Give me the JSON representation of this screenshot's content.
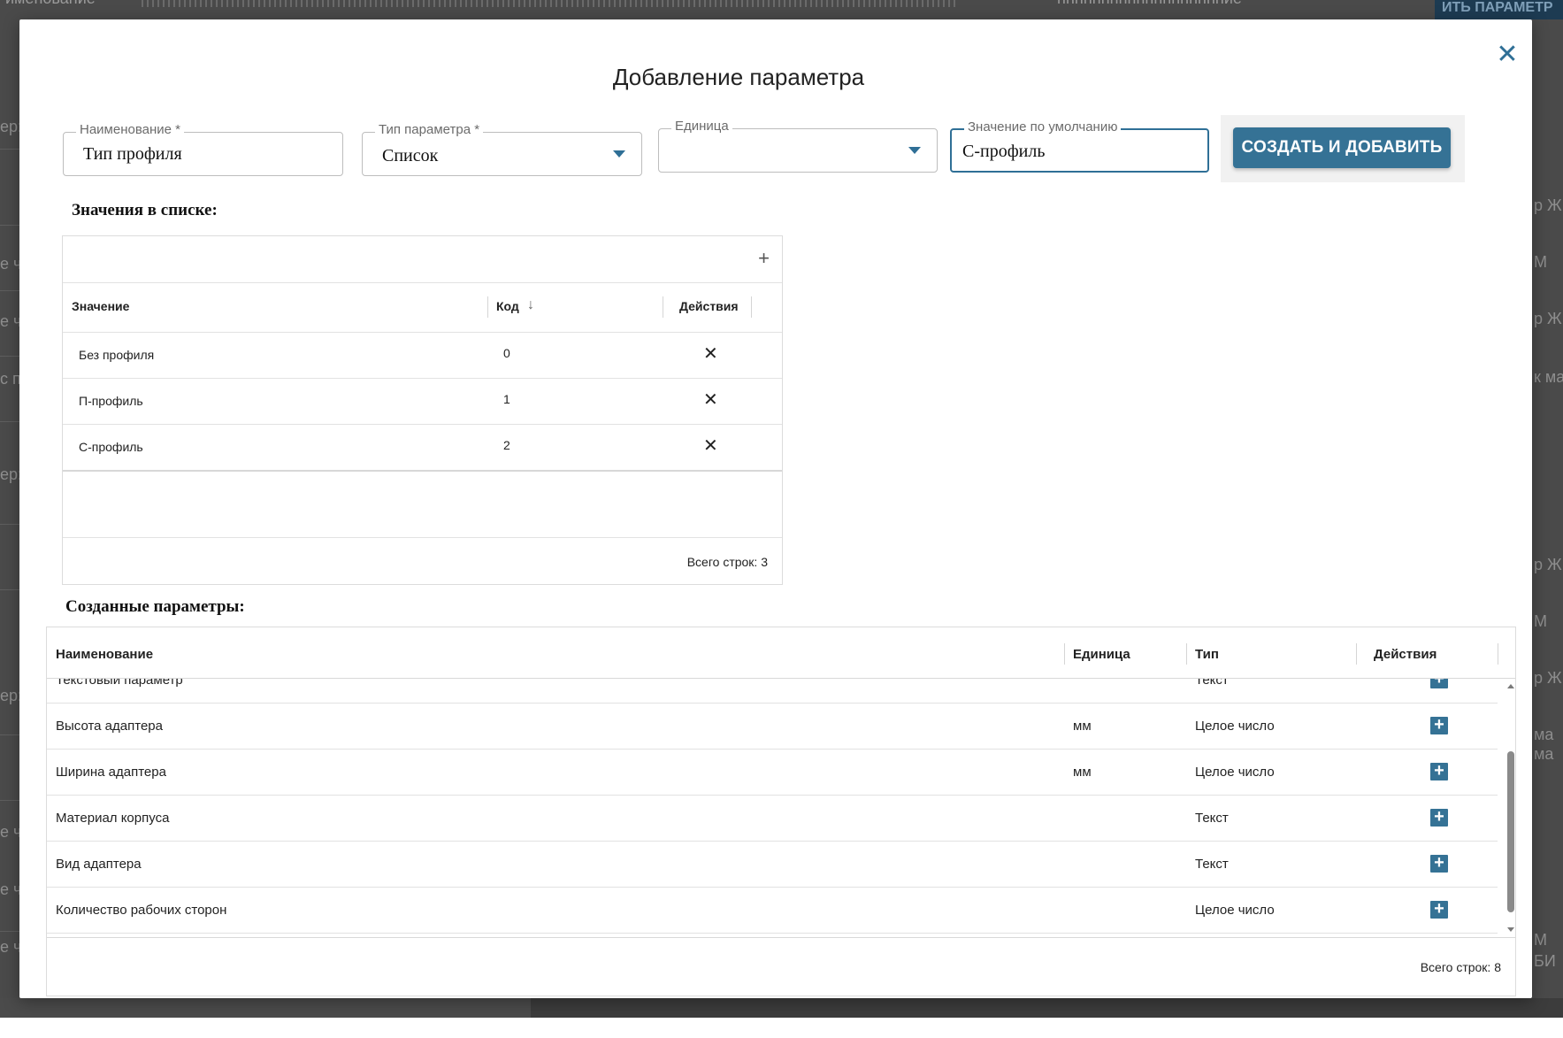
{
  "background": {
    "top_left_text": "именование",
    "top_mid_text": "ннннннннннннннннннние",
    "top_button": "ИТЬ ПАРАМЕТР",
    "left_fragments": [
      "ер:",
      "е ч",
      "е ч",
      "с п",
      "ер:",
      "ер:",
      "е ч",
      "е ч",
      "е ч"
    ],
    "right_fragments": [
      "р Ж",
      "М",
      "р Ж",
      "к ма",
      "р Ж",
      "М",
      "р Ж",
      "ма",
      "ма",
      "М",
      "БИ"
    ]
  },
  "dialog": {
    "title": "Добавление параметра",
    "close_icon": "close-icon",
    "fields": {
      "name": {
        "label": "Наименование *",
        "value": "Тип профиля"
      },
      "type": {
        "label": "Тип параметра *",
        "value": "Список"
      },
      "unit": {
        "label": "Единица",
        "value": ""
      },
      "default": {
        "label": "Значение по умолчанию",
        "value": "С-профиль"
      }
    },
    "create_button": "СОЗДАТЬ И ДОБАВИТЬ",
    "accent_color": "#357295"
  },
  "values_section": {
    "heading": "Значения в списке:",
    "add_icon": "plus-icon",
    "columns": [
      "Значение",
      "Код",
      "Действия"
    ],
    "sort_icon": "arrow-down-icon",
    "rows": [
      {
        "value": "Без профиля",
        "code": "0"
      },
      {
        "value": "П-профиль",
        "code": "1"
      },
      {
        "value": "С-профиль",
        "code": "2"
      }
    ],
    "delete_icon": "close-icon",
    "footer": "Всего строк: 3"
  },
  "params_section": {
    "heading": "Созданные параметры:",
    "columns": [
      "Наименование",
      "Единица",
      "Тип",
      "Действия"
    ],
    "rows": [
      {
        "name": "Текстовый параметр",
        "unit": "",
        "type": "Текст"
      },
      {
        "name": "Высота адаптера",
        "unit": "мм",
        "type": "Целое число"
      },
      {
        "name": "Ширина адаптера",
        "unit": "мм",
        "type": "Целое число"
      },
      {
        "name": "Материал корпуса",
        "unit": "",
        "type": "Текст"
      },
      {
        "name": "Вид адаптера",
        "unit": "",
        "type": "Текст"
      },
      {
        "name": "Количество рабочих сторон",
        "unit": "",
        "type": "Целое число"
      }
    ],
    "add_icon": "plus-square-icon",
    "footer": "Всего строк: 8"
  }
}
